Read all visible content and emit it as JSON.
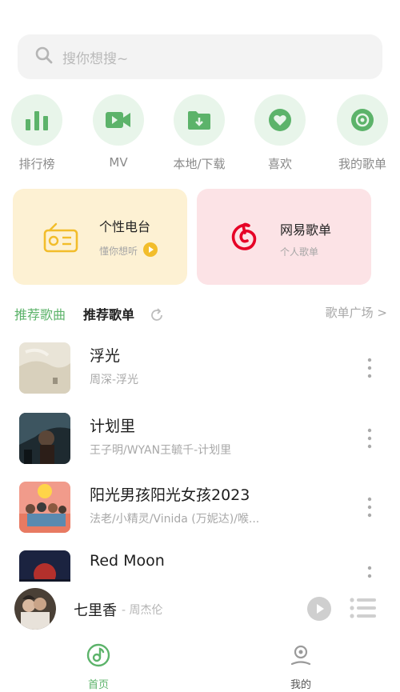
{
  "search": {
    "placeholder": "搜你想搜~"
  },
  "quick_actions": [
    {
      "label": "排行榜",
      "icon": "bar-chart-icon"
    },
    {
      "label": "MV",
      "icon": "video-camera-icon"
    },
    {
      "label": "本地/下载",
      "icon": "download-folder-icon"
    },
    {
      "label": "喜欢",
      "icon": "heart-icon"
    },
    {
      "label": "我的歌单",
      "icon": "disc-icon"
    }
  ],
  "cards": {
    "radio": {
      "title": "个性电台",
      "subtitle": "懂你想听",
      "icon": "radio-icon"
    },
    "netease": {
      "title": "网易歌单",
      "subtitle": "个人歌单",
      "icon": "netease-music-icon"
    }
  },
  "tabs": {
    "recommend_songs": "推荐歌曲",
    "recommend_playlists": "推荐歌单",
    "plaza": "歌单广场 >"
  },
  "songs": [
    {
      "title": "浮光",
      "artist": "周深-浮光"
    },
    {
      "title": "计划里",
      "artist": "王子明/WYAN王毓千-计划里"
    },
    {
      "title": "阳光男孩阳光女孩2023",
      "artist": "法老/小精灵/Vinida (万妮达)/喉..."
    },
    {
      "title": "Red Moon",
      "artist": ""
    }
  ],
  "player": {
    "title": "七里香",
    "artist": " - 周杰伦"
  },
  "nav": [
    {
      "label": "首页",
      "active": true
    },
    {
      "label": "我的",
      "active": false
    }
  ],
  "colors": {
    "accent_green": "#5cb36a",
    "icon_bg_green": "#e8f5ea",
    "radio_card_bg": "#fdf1d3",
    "netease_card_bg": "#fce3e6",
    "netease_red": "#e60026",
    "radio_yellow": "#f2bd2b"
  }
}
